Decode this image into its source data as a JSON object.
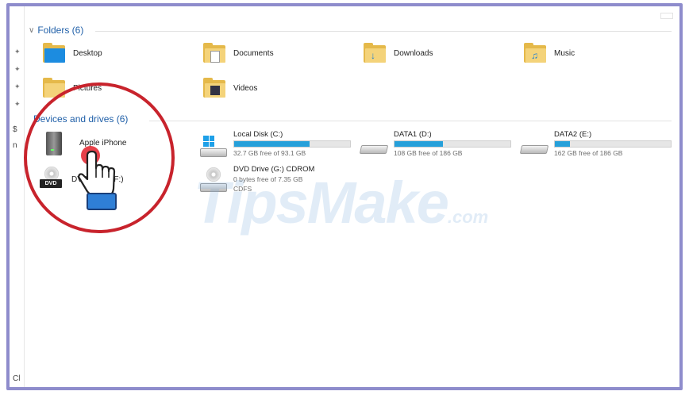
{
  "folders_section": {
    "label": "Folders (6)"
  },
  "folders": [
    {
      "name": "Desktop",
      "icon": "desktop-folder-icon"
    },
    {
      "name": "Documents",
      "icon": "documents-folder-icon"
    },
    {
      "name": "Downloads",
      "icon": "downloads-folder-icon"
    },
    {
      "name": "Music",
      "icon": "music-folder-icon"
    },
    {
      "name": "Pictures",
      "icon": "pictures-folder-icon"
    },
    {
      "name": "Videos",
      "icon": "videos-folder-icon"
    }
  ],
  "devices_section": {
    "label": "Devices and drives (6)"
  },
  "devices": [
    {
      "name": "Apple iPhone",
      "icon": "iphone-device-icon"
    },
    {
      "name": "DVD Drive (F:)",
      "icon": "dvd-drive-icon"
    },
    {
      "name": "Local Disk (C:)",
      "free": "32.7 GB free of 93.1 GB",
      "used_fraction": 0.65,
      "icon": "windows-drive-icon"
    },
    {
      "name": "DATA1 (D:)",
      "free": "108 GB free of 186 GB",
      "used_fraction": 0.42,
      "icon": "hard-drive-icon"
    },
    {
      "name": "DATA2 (E:)",
      "free": "162 GB free of 186 GB",
      "used_fraction": 0.13,
      "icon": "hard-drive-icon"
    },
    {
      "name": "DVD Drive (G:) CDROM",
      "free": "0 bytes free of 7.35 GB",
      "fs": "CDFS",
      "icon": "cdrom-drive-icon"
    }
  ],
  "left_strip": {
    "top_char": "$",
    "middle_char": "n",
    "bottom_label": "Cl"
  },
  "watermark": {
    "main": "TipsMake",
    "suffix": ".com"
  },
  "colors": {
    "accent": "#26a0da",
    "section": "#1f5fa8",
    "highlight": "#c8232c",
    "frame": "#8e8ccc"
  }
}
